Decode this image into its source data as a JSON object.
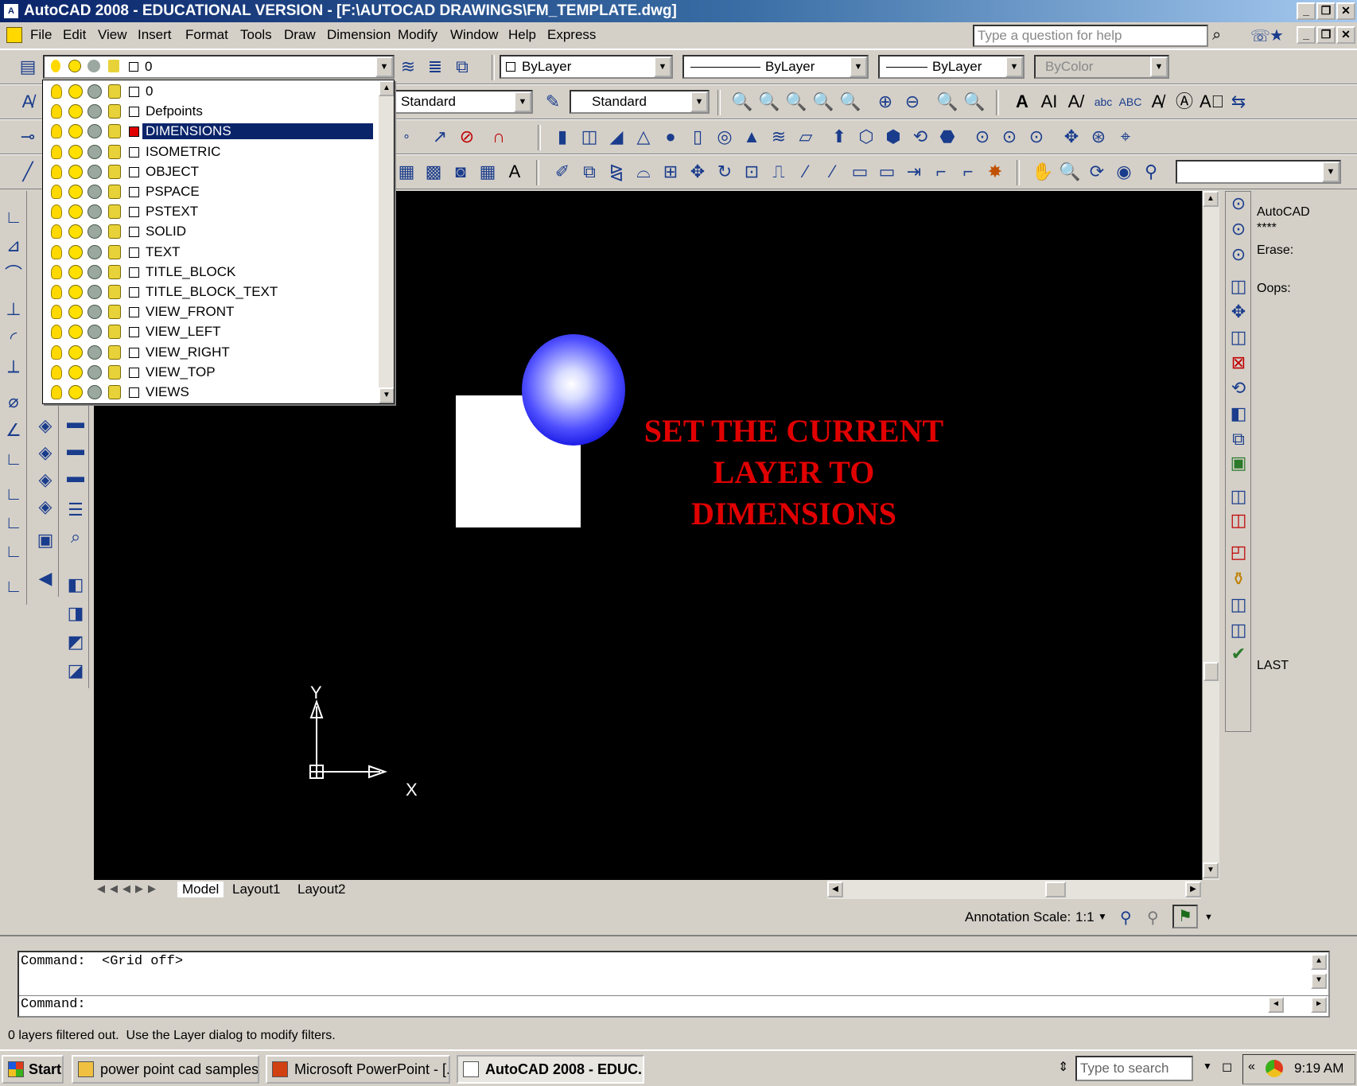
{
  "window": {
    "title": "AutoCAD 2008 - EDUCATIONAL VERSION - [F:\\AUTOCAD DRAWINGS\\FM_TEMPLATE.dwg]",
    "icon": "autocad-icon"
  },
  "menu": [
    "File",
    "Edit",
    "View",
    "Insert",
    "Format",
    "Tools",
    "Draw",
    "Dimension",
    "Modify",
    "Window",
    "Help",
    "Express"
  ],
  "help_search": {
    "placeholder": "Type a question for help"
  },
  "toolbar": {
    "layer_current": "0",
    "color": "ByLayer",
    "linetype": "ByLayer",
    "lineweight": "ByLayer",
    "plotstyle": "ByColor",
    "text_style": "Standard",
    "dim_style": "Standard",
    "text_glyph": "A"
  },
  "layers": [
    {
      "name": "0",
      "color": "#ffffff"
    },
    {
      "name": "Defpoints",
      "color": "#ffffff"
    },
    {
      "name": "DIMENSIONS",
      "color": "#e00000",
      "selected": true
    },
    {
      "name": "ISOMETRIC",
      "color": "#ffffff"
    },
    {
      "name": "OBJECT",
      "color": "#ffffff"
    },
    {
      "name": "PSPACE",
      "color": "#ffffff"
    },
    {
      "name": "PSTEXT",
      "color": "#ffffff"
    },
    {
      "name": "SOLID",
      "color": "#ffffff"
    },
    {
      "name": "TEXT",
      "color": "#ffffff"
    },
    {
      "name": "TITLE_BLOCK",
      "color": "#ffffff"
    },
    {
      "name": "TITLE_BLOCK_TEXT",
      "color": "#ffffff"
    },
    {
      "name": "VIEW_FRONT",
      "color": "#ffffff"
    },
    {
      "name": "VIEW_LEFT",
      "color": "#ffffff"
    },
    {
      "name": "VIEW_RIGHT",
      "color": "#ffffff"
    },
    {
      "name": "VIEW_TOP",
      "color": "#ffffff"
    },
    {
      "name": "VIEWS",
      "color": "#ffffff"
    }
  ],
  "canvas": {
    "annotation_lines": [
      "SET THE CURRENT",
      "LAYER TO",
      "DIMENSIONS"
    ],
    "annotation_color": "#e00000",
    "ucs": {
      "x_label": "X",
      "y_label": "Y"
    }
  },
  "layout_tabs": [
    "Model",
    "Layout1",
    "Layout2"
  ],
  "status": {
    "annotation_scale_label": "Annotation Scale:",
    "annotation_scale_value": "1:1"
  },
  "command": {
    "history": "Command:  <Grid off>",
    "prompt": "Command:"
  },
  "message": "0 layers filtered out.  Use the Layer dialog to modify filters.",
  "side_panel": {
    "title": "AutoCAD",
    "stars": "****",
    "items": [
      "Erase:",
      "Oops:"
    ],
    "last": "LAST"
  },
  "taskbar": {
    "start": "Start",
    "buttons": [
      "power point cad samples",
      "Microsoft PowerPoint - [...",
      "AutoCAD 2008 - EDUC..."
    ],
    "search_placeholder": "Type to search",
    "clock": "9:19 AM"
  }
}
